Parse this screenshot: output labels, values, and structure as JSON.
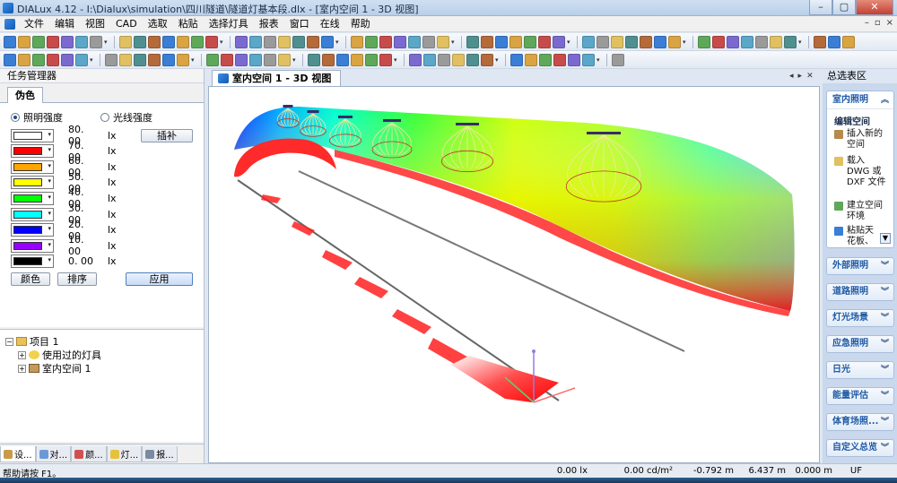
{
  "window": {
    "title": "DIALux 4.12 - I:\\Dialux\\simulation\\四川隧道\\隧道灯基本段.dlx - [室内空间 1 - 3D 视图]",
    "buttons": [
      "–",
      "▢",
      "✕"
    ]
  },
  "menu": {
    "items": [
      "文件",
      "编辑",
      "视图",
      "CAD",
      "选取",
      "粘贴",
      "选择灯具",
      "报表",
      "窗口",
      "在线",
      "帮助"
    ],
    "mdi_buttons": [
      "–",
      "▫",
      "×"
    ]
  },
  "toolbar1": {
    "icons": [
      "select-arrow-icon",
      "new-icon",
      "open-icon",
      "save-icon",
      "print-icon",
      "print-preview-icon",
      "pdf-icon",
      "cut-icon",
      "copy-icon",
      "paste-icon",
      "undo-icon",
      "redo-icon",
      "delete-icon",
      "cube-blue-icon",
      "l-shape-icon",
      "room-icon",
      "window-icon",
      "door-icon",
      "column-icon",
      "stair-icon",
      "no-icon",
      "pipe-icon",
      "light-icon",
      "render-icon",
      "calc-icon",
      "tool-icon",
      "wrench-icon",
      "ruler-icon",
      "grid-icon",
      "box3d-icon",
      "box3d-b-icon",
      "paint-icon",
      "texture-icon",
      "light-a-icon",
      "light-b-icon",
      "view-icon",
      "camera-icon",
      "red-circle-icon",
      "orange-circle-icon",
      "grid-a-icon",
      "grid-b-icon",
      "grid-c-icon",
      "grid-d-icon",
      "grid-e-icon",
      "list-icon",
      "globe-icon",
      "doc-icon",
      "search-icon",
      "film-icon",
      "star-icon",
      "table-icon",
      "split-icon"
    ]
  },
  "toolbar2": {
    "icons": [
      "arrow-add-icon",
      "arrow-right-icon",
      "zoom-a-icon",
      "zoom-b-icon",
      "zoom-c-icon",
      "zoom-d-icon",
      "zoom-e-icon",
      "rotate-a-icon",
      "rotate-b-icon",
      "lamp-red-icon",
      "lamp-red2-icon",
      "lamp-red3-icon",
      "cursor-icon",
      "pan-icon",
      "orbit-icon",
      "fly-icon",
      "walk-icon",
      "box-a-icon",
      "box-b-icon",
      "plane-icon",
      "cam-icon",
      "cam2-icon",
      "cam3-icon",
      "cam4-icon",
      "cam5-icon",
      "cam6-icon",
      "frame-icon",
      "iso-icon",
      "iso2-icon",
      "front-icon",
      "side-icon",
      "top-icon",
      "line-icon",
      "poly-icon",
      "circle-icon",
      "dot-icon",
      "move-icon"
    ]
  },
  "task_manager": {
    "title": "任务管理器",
    "tab": "伪色",
    "radio_illuminance": "照明强度",
    "radio_luminance": "光线强度",
    "interpolate_button": "插补",
    "colors": [
      {
        "color": "#ffffff",
        "value": "80. 00",
        "unit": "lx"
      },
      {
        "color": "#ff0000",
        "value": "70. 00",
        "unit": "lx"
      },
      {
        "color": "#ffa500",
        "value": "60. 00",
        "unit": "lx"
      },
      {
        "color": "#ffff00",
        "value": "50. 00",
        "unit": "lx"
      },
      {
        "color": "#00ff00",
        "value": "40. 00",
        "unit": "lx"
      },
      {
        "color": "#00ffff",
        "value": "30. 00",
        "unit": "lx"
      },
      {
        "color": "#0000ff",
        "value": "20. 00",
        "unit": "lx"
      },
      {
        "color": "#9900ff",
        "value": "10. 00",
        "unit": "lx"
      },
      {
        "color": "#000000",
        "value": "0. 00",
        "unit": "lx"
      }
    ],
    "color_button": "颜色",
    "sort_button": "排序",
    "apply_button": "应用"
  },
  "tree": {
    "project": "项目 1",
    "used_luminaires": "使用过的灯具",
    "room": "室内空间 1"
  },
  "bottom_tabs": [
    "设...",
    "对...",
    "颜...",
    "灯...",
    "报..."
  ],
  "document_tab": "室内空间 1 - 3D 视图",
  "view_controls": [
    "◂",
    "▸",
    "✕"
  ],
  "right_panel": {
    "title": "总选表区",
    "indoor": "室内照明",
    "edit_room": "编辑空间",
    "links": [
      "插入新的空间",
      "载入 DWG 或 DXF 文件",
      "建立空间环境",
      "粘贴天花板、"
    ],
    "sections": [
      "外部照明",
      "道路照明",
      "灯光场景",
      "应急照明",
      "日光",
      "能量评估",
      "体育场照...",
      "自定义总览"
    ]
  },
  "status": {
    "help": "帮助请按 F1。",
    "illuminance": "0.00 lx",
    "luminance": "0.00 cd/m²",
    "x": "-0.792 m",
    "y": "6.437 m",
    "z": "0.000 m",
    "uf": "UF"
  },
  "colors": {
    "accent": "#1f5aa6",
    "panel": "#c9d8ec",
    "red": "#ff0000"
  }
}
